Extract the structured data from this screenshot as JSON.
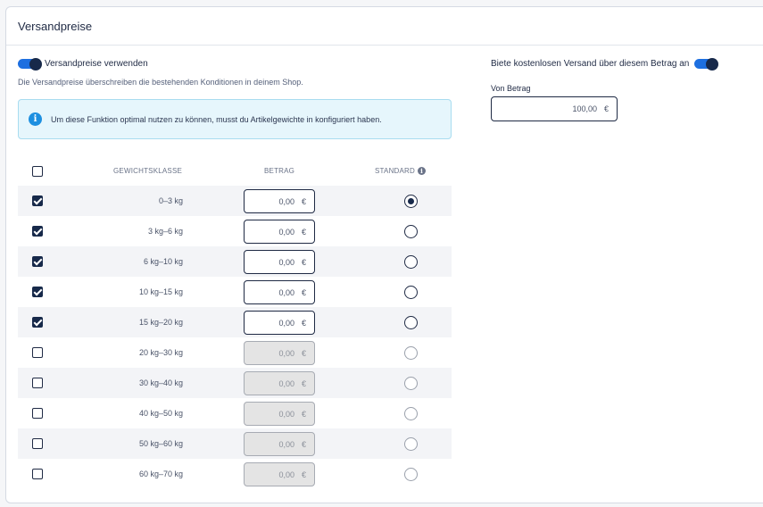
{
  "card": {
    "title": "Versandpreise"
  },
  "left": {
    "toggle_label": "Versandpreise verwenden",
    "toggle_on": true,
    "hint": "Die Versandpreise überschreiben die bestehenden Konditionen in deinem Shop.",
    "info": "Um diese Funktion optimal nutzen zu können, musst du Artikelgewichte in konfiguriert haben."
  },
  "right": {
    "toggle_label": "Biete kostenlosen Versand über diesem Betrag an",
    "toggle_on": true,
    "von_label": "Von Betrag",
    "von_value": "100,00",
    "currency": "€"
  },
  "table": {
    "headers": {
      "weight": "GEWICHTSKLASSE",
      "amount": "BETRAG",
      "standard": "STANDARD"
    },
    "currency": "€",
    "rows": [
      {
        "weight": "0–3 kg",
        "amount": "0,00",
        "checked": true,
        "standard": true
      },
      {
        "weight": "3 kg–6 kg",
        "amount": "0,00",
        "checked": true,
        "standard": false
      },
      {
        "weight": "6 kg–10 kg",
        "amount": "0,00",
        "checked": true,
        "standard": false
      },
      {
        "weight": "10 kg–15 kg",
        "amount": "0,00",
        "checked": true,
        "standard": false
      },
      {
        "weight": "15 kg–20 kg",
        "amount": "0,00",
        "checked": true,
        "standard": false
      },
      {
        "weight": "20 kg–30 kg",
        "amount": "0,00",
        "checked": false,
        "standard": false
      },
      {
        "weight": "30 kg–40 kg",
        "amount": "0,00",
        "checked": false,
        "standard": false
      },
      {
        "weight": "40 kg–50 kg",
        "amount": "0,00",
        "checked": false,
        "standard": false
      },
      {
        "weight": "50 kg–60 kg",
        "amount": "0,00",
        "checked": false,
        "standard": false
      },
      {
        "weight": "60 kg–70 kg",
        "amount": "0,00",
        "checked": false,
        "standard": false
      }
    ]
  }
}
